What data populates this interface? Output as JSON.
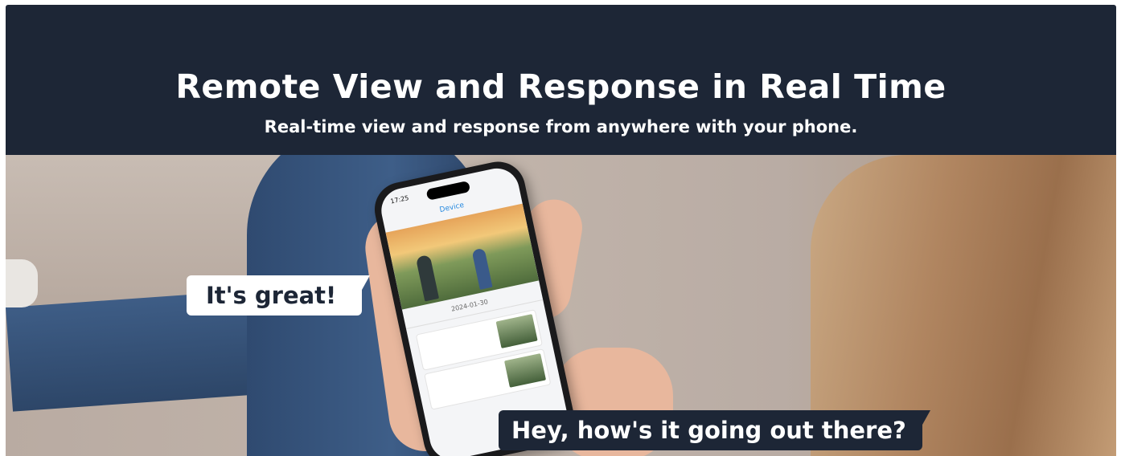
{
  "header": {
    "title": "Remote View and Response in Real Time",
    "subtitle": "Real-time view and response from anywhere with your phone."
  },
  "bubbles": {
    "left": "It's great!",
    "right": "Hey, how's it going out there?"
  },
  "phone": {
    "status_time": "17:25",
    "nav_title": "Device",
    "date_label": "2024-01-30"
  },
  "colors": {
    "header_bg": "#1d2636",
    "header_text": "#ffffff",
    "bubble_light": "#ffffff",
    "bubble_dark": "#1d2636"
  }
}
